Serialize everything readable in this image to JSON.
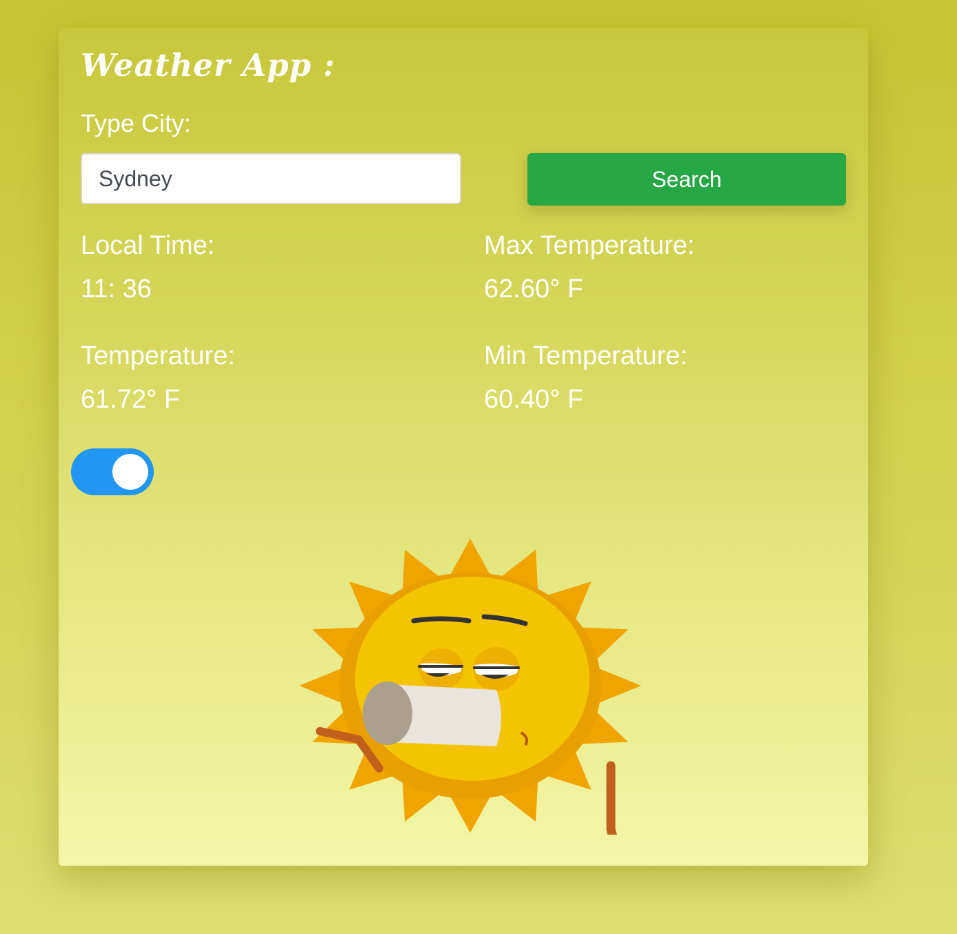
{
  "app": {
    "title": "Weather App :"
  },
  "search": {
    "label": "Type City:",
    "value": "Sydney",
    "button_label": "Search"
  },
  "stats": {
    "local_time": {
      "label": "Local Time:",
      "value": "11: 36"
    },
    "temperature": {
      "label": "Temperature:",
      "value": "61.72° F"
    },
    "max_temperature": {
      "label": "Max Temperature:",
      "value": "62.60° F"
    },
    "min_temperature": {
      "label": "Min Temperature:",
      "value": "60.40° F"
    }
  },
  "toggle": {
    "on": true,
    "color": "#2196f3"
  },
  "colors": {
    "accent_button": "#28a745",
    "sun_body": "#f5c400",
    "sun_rays": "#f0a400"
  },
  "illustration": {
    "icon": "sun-drinking-icon"
  }
}
